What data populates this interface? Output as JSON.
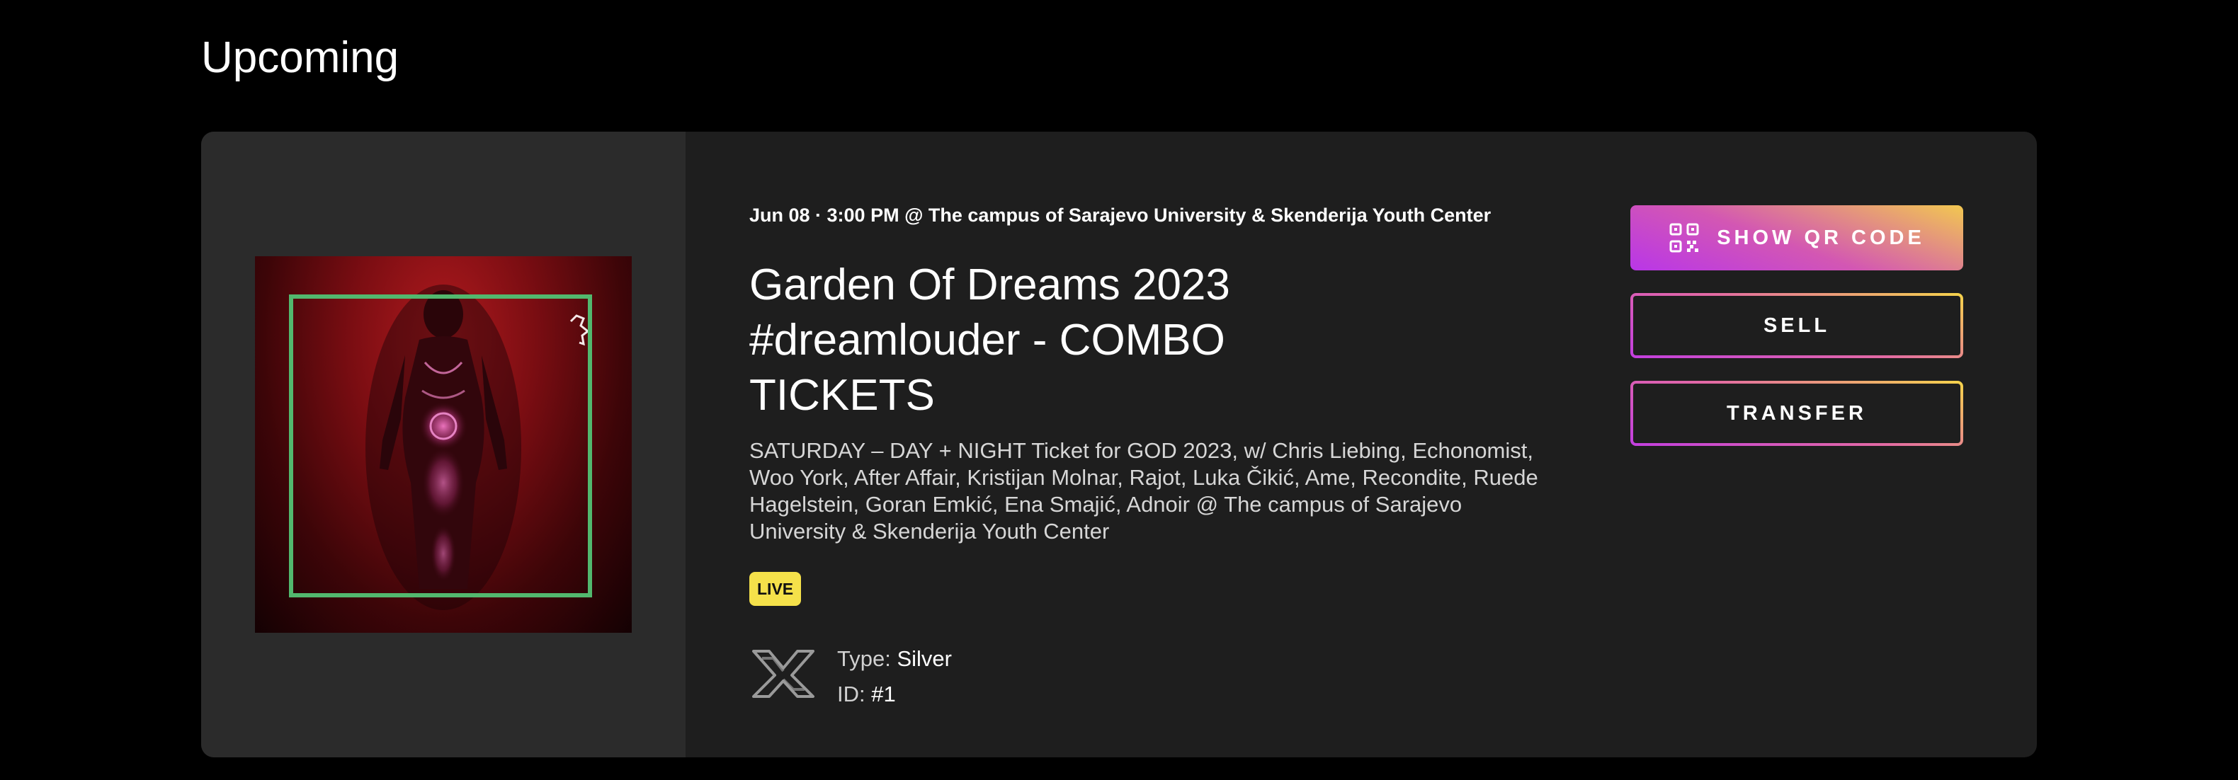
{
  "section": {
    "title": "Upcoming"
  },
  "event": {
    "meta": "Jun 08 · 3:00 PM @ The campus of Sarajevo University & Skenderija Youth Center",
    "title": "Garden Of Dreams 2023 #dreamlouder - COMBO TICKETS",
    "description": "SATURDAY – DAY + NIGHT Ticket for GOD 2023, w/ Chris Liebing, Echonomist, Woo York, After Affair, Kristijan Molnar, Rajot, Luka Čikić, Ame, Recondite, Ruede Hagelstein, Goran Emkić, Ena Smajić, Adnoir @ The campus of Sarajevo University & Skenderija Youth Center",
    "status_badge": "LIVE"
  },
  "ticket": {
    "type_label": "Type:",
    "type_value": "Silver",
    "id_label": "ID:",
    "id_value": "#1",
    "logo_icon": "xp-brand-icon"
  },
  "actions": {
    "show_qr_label": "SHOW QR CODE",
    "sell_label": "SELL",
    "transfer_label": "TRANSFER",
    "qr_icon": "qr-code-icon"
  },
  "colors": {
    "background": "#000000",
    "card": "#1e1e1e",
    "art_panel": "#2b2b2b",
    "badge": "#f5e14a",
    "gradient_start": "#b936e8",
    "gradient_end": "#f2c850",
    "frame": "#52b86e"
  }
}
